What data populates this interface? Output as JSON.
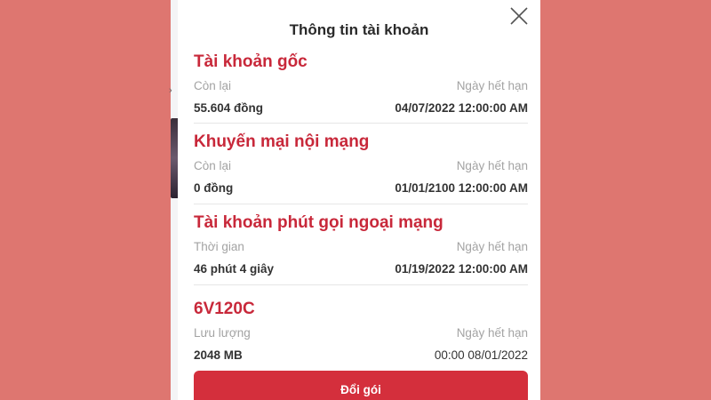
{
  "modal": {
    "title": "Thông tin tài khoản",
    "close_icon": "close-icon"
  },
  "accounts": [
    {
      "title": "Tài khoản gốc",
      "left_label": "Còn lại",
      "right_label": "Ngày hết hạn",
      "left_value": "55.604 đồng",
      "right_value": "04/07/2022 12:00:00 AM"
    },
    {
      "title": "Khuyến mại nội mạng",
      "left_label": "Còn lại",
      "right_label": "Ngày hết hạn",
      "left_value": "0 đồng",
      "right_value": "01/01/2100 12:00:00 AM"
    },
    {
      "title": "Tài khoản phút gọi ngoại mạng",
      "left_label": "Thời gian",
      "right_label": "Ngày hết hạn",
      "left_value": "46 phút 4 giây",
      "right_value": "01/19/2022 12:00:00 AM"
    },
    {
      "title": "6V120C",
      "left_label": "Lưu lượng",
      "right_label": "Ngày hết hạn",
      "left_value": "2048 MB",
      "right_value": "00:00 08/01/2022"
    }
  ],
  "actions": {
    "change_package_label": "Đổi gói"
  },
  "colors": {
    "background": "#de7670",
    "accent": "#c8283a",
    "button": "#d42f3c"
  }
}
